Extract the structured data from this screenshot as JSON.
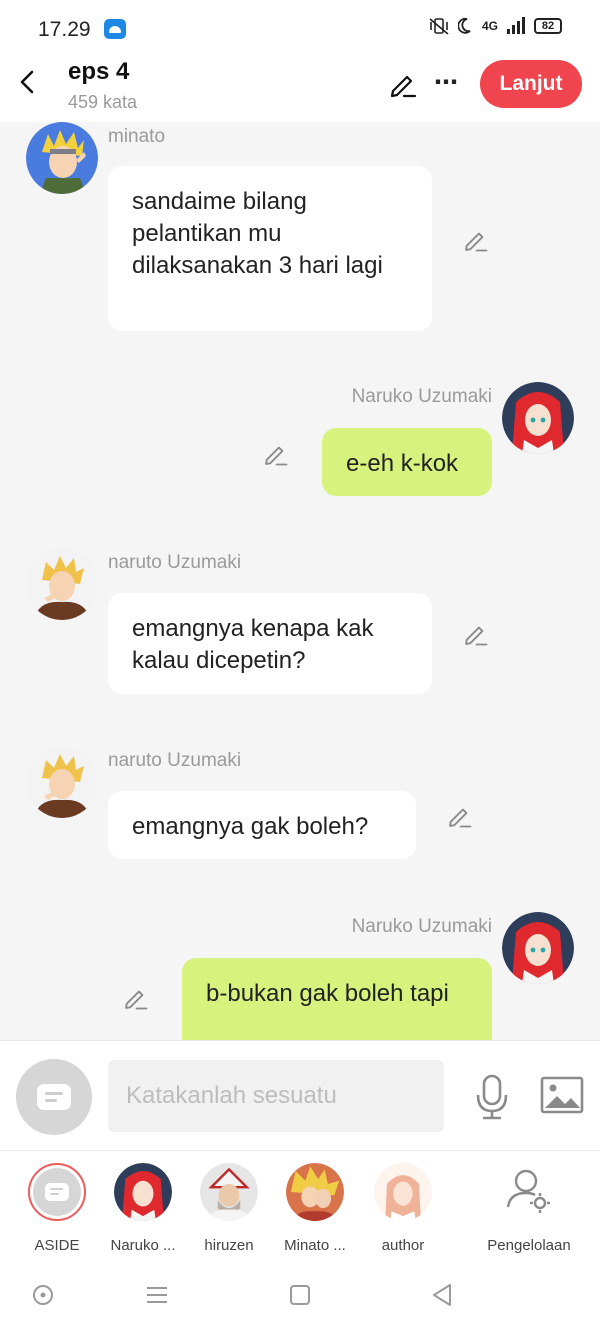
{
  "status_bar": {
    "time": "17.29",
    "network": "4G",
    "battery": "82"
  },
  "header": {
    "title": "eps 4",
    "subtitle": "459 kata",
    "next_label": "Lanjut",
    "more_label": "⋯"
  },
  "messages": [
    {
      "speaker": "minato",
      "text": "sandaime bilang pelantikan mu dilaksanakan 3 hari lagi",
      "side": "left"
    },
    {
      "speaker": "Naruko Uzumaki",
      "text": "e-eh k-kok",
      "side": "right"
    },
    {
      "speaker": "naruto Uzumaki",
      "text": "emangnya kenapa kak kalau dicepetin?",
      "side": "left"
    },
    {
      "speaker": "naruto Uzumaki",
      "text": "emangnya gak boleh?",
      "side": "left"
    },
    {
      "speaker": "Naruko Uzumaki",
      "text": "b-bukan gak boleh tapi",
      "side": "right"
    }
  ],
  "input": {
    "placeholder": "Katakanlah sesuatu"
  },
  "characters": [
    {
      "label": "ASIDE"
    },
    {
      "label": "Naruko ..."
    },
    {
      "label": "hiruzen"
    },
    {
      "label": "Minato ..."
    },
    {
      "label": "author"
    },
    {
      "label": "Pengelolaan"
    }
  ],
  "colors": {
    "accent": "#f0454f",
    "right_bubble": "#d7f27d",
    "left_bubble": "#ffffff",
    "background": "#f5f5f5"
  }
}
